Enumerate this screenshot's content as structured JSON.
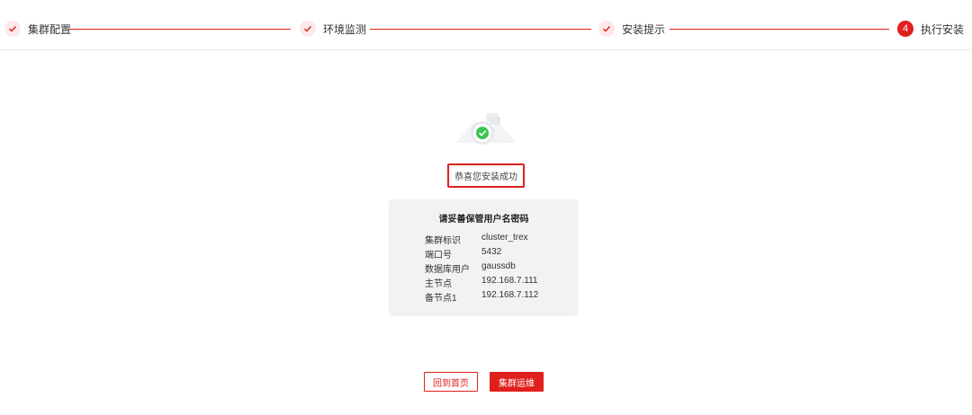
{
  "stepper": {
    "steps": [
      {
        "label": "集群配置",
        "state": "done"
      },
      {
        "label": "环境监测",
        "state": "done"
      },
      {
        "label": "安装提示",
        "state": "done"
      },
      {
        "label": "执行安装",
        "state": "active",
        "number": "4"
      }
    ]
  },
  "result": {
    "message": "恭喜您安装成功"
  },
  "credentials": {
    "title": "请妥善保管用户名密码",
    "rows": [
      {
        "key": "集群标识",
        "value": "cluster_trex"
      },
      {
        "key": "端口号",
        "value": "5432"
      },
      {
        "key": "数据库用户",
        "value": "gaussdb"
      },
      {
        "key": "主节点",
        "value": "192.168.7.111"
      },
      {
        "key": "备节点1",
        "value": "192.168.7.112"
      }
    ]
  },
  "actions": {
    "home_label": "回到首页",
    "ops_label": "集群运维"
  },
  "colors": {
    "accent": "#e0201d",
    "success": "#3cc354"
  }
}
